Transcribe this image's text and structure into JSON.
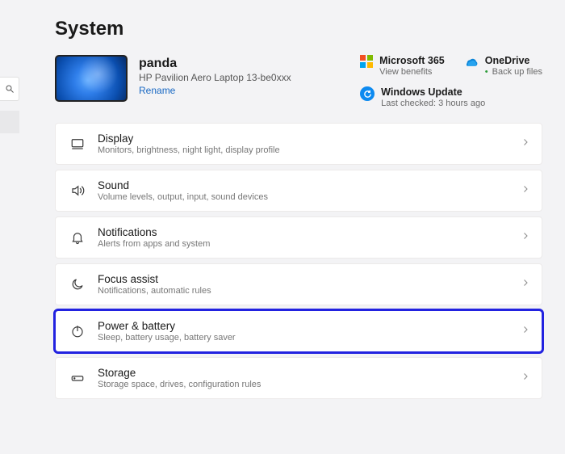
{
  "title": "System",
  "device": {
    "name": "panda",
    "model": "HP Pavilion Aero Laptop 13-be0xxx",
    "rename_label": "Rename"
  },
  "quicklinks": {
    "ms365": {
      "title": "Microsoft 365",
      "sub": "View benefits"
    },
    "onedrive": {
      "title": "OneDrive",
      "sub": "Back up files"
    },
    "winupdate": {
      "title": "Windows Update",
      "sub": "Last checked: 3 hours ago"
    }
  },
  "rows": [
    {
      "id": "display",
      "title": "Display",
      "sub": "Monitors, brightness, night light, display profile"
    },
    {
      "id": "sound",
      "title": "Sound",
      "sub": "Volume levels, output, input, sound devices"
    },
    {
      "id": "notifications",
      "title": "Notifications",
      "sub": "Alerts from apps and system"
    },
    {
      "id": "focus-assist",
      "title": "Focus assist",
      "sub": "Notifications, automatic rules"
    },
    {
      "id": "power-battery",
      "title": "Power & battery",
      "sub": "Sleep, battery usage, battery saver",
      "highlight": true
    },
    {
      "id": "storage",
      "title": "Storage",
      "sub": "Storage space, drives, configuration rules"
    }
  ]
}
